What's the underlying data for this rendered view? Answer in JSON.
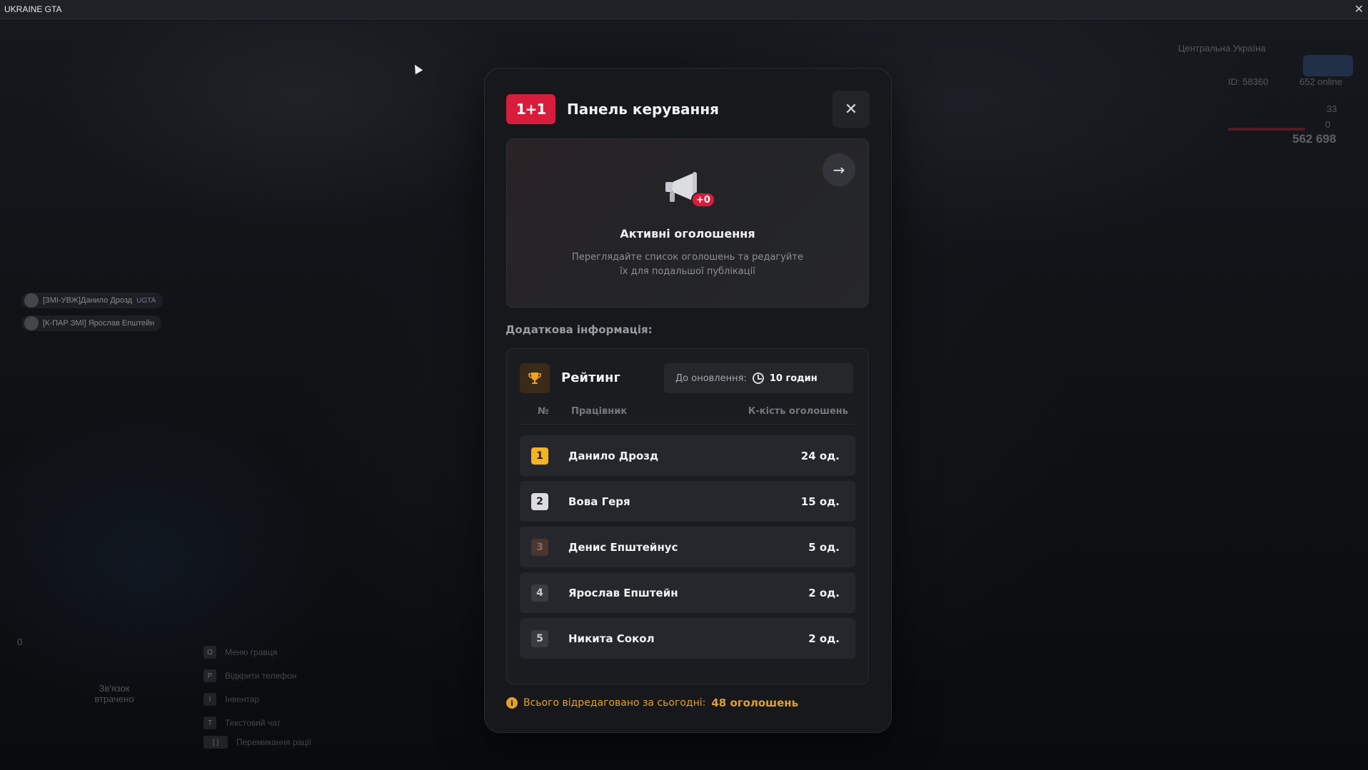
{
  "window": {
    "title": "UKRAINE GTA",
    "close_glyph": "✕"
  },
  "hud": {
    "region": "Центральна Україна",
    "player_id": "ID: 58360",
    "online": "652 online",
    "health": "33",
    "armor": "0",
    "money": "562 698"
  },
  "voice": [
    {
      "name": "[ЗМІ-УВЖ]Данило Дрозд",
      "tag": "UGTA"
    },
    {
      "name": "[К-ПАР ЗМІ] Ярослав Епштейн",
      "tag": ""
    }
  ],
  "hints": [
    {
      "key": "O",
      "label": "Меню гравця"
    },
    {
      "key": "P",
      "label": "Відкрити телефон"
    },
    {
      "key": "I",
      "label": "Інвентар"
    },
    {
      "key": "T",
      "label": "Текстовий чат"
    },
    {
      "key": "[ ]",
      "label": "Перемикання рації"
    }
  ],
  "left_status": {
    "value": "0",
    "voice_text": "Зв'язок втрачено"
  },
  "modal": {
    "logo": "1+1",
    "title": "Панель керування",
    "close_glyph": "✕",
    "announcements": {
      "badge": "+0",
      "title": "Активні оголошення",
      "description": "Переглядайте список оголошень та редагуйте їх для подальшої публікації",
      "arrow_glyph": "→"
    },
    "section_label": "Додаткова інформація:",
    "rating": {
      "title": "Рейтинг",
      "timer_label": "До оновлення:",
      "timer_value": "10 годин",
      "columns": {
        "num": "№",
        "name": "Працівник",
        "count": "К-кість оголошень"
      },
      "rows": [
        {
          "rank": "1",
          "name": "Данило Дрозд",
          "count": "24 од.",
          "badge_bg": "#f3b325",
          "badge_fg": "#1b1c20"
        },
        {
          "rank": "2",
          "name": "Вова Геря",
          "count": "15 од.",
          "badge_bg": "#dcdce0",
          "badge_fg": "#1b1c20"
        },
        {
          "rank": "3",
          "name": "Денис Епштейнус",
          "count": "5 од.",
          "badge_bg": "#4a3530",
          "badge_fg": "#8a6a60"
        },
        {
          "rank": "4",
          "name": "Ярослав Епштейн",
          "count": "2 од.",
          "badge_bg": "#3a3b40",
          "badge_fg": "#c8c8cc"
        },
        {
          "rank": "5",
          "name": "Никита Сокол",
          "count": "2 од.",
          "badge_bg": "#3a3b40",
          "badge_fg": "#c8c8cc"
        }
      ]
    },
    "footer": {
      "label": "Всього відредаговано за сьогодні:",
      "value": "48 оголошень"
    }
  },
  "colors": {
    "accent": "#d81d3c",
    "gold": "#e0a12a"
  }
}
